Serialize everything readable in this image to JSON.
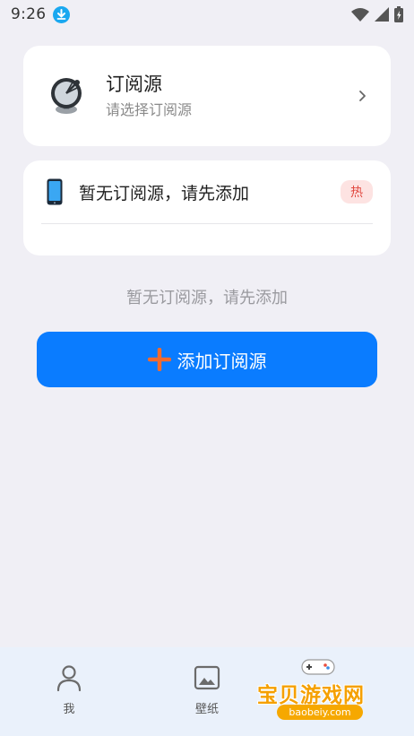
{
  "status_bar": {
    "time": "9:26",
    "icons": [
      "download-badge-icon",
      "wifi-icon",
      "signal-icon",
      "battery-charging-icon"
    ]
  },
  "source_card": {
    "title": "订阅源",
    "subtitle": "请选择订阅源",
    "icon": "satellite-dish-icon"
  },
  "source_list": {
    "item_text": "暂无订阅源，请先添加",
    "badge": "热",
    "icon": "phone-icon"
  },
  "empty_hint": "暂无订阅源，请先添加",
  "add_button": {
    "label": "添加订阅源",
    "icon": "plus-icon"
  },
  "bottom_tabs": [
    {
      "label": "我",
      "icon": "person-icon"
    },
    {
      "label": "壁纸",
      "icon": "image-icon"
    }
  ],
  "watermark": {
    "text": "宝贝游戏网",
    "url": "baobeiy.com"
  },
  "colors": {
    "accent": "#0a7cff",
    "plus": "#f26a2e",
    "hot_badge_bg": "#fde3e2",
    "hot_badge_text": "#e1483f",
    "background": "#f0eff5"
  }
}
